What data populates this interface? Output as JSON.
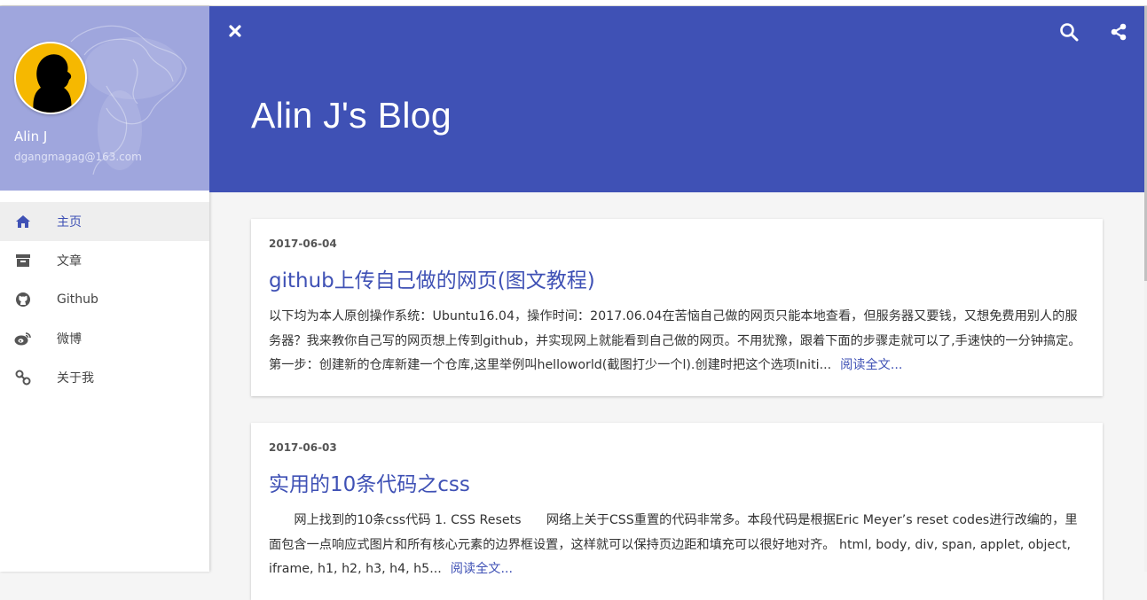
{
  "profile": {
    "name": "Alin J",
    "email": "dgangmagag@163.com"
  },
  "nav": {
    "items": [
      {
        "label": "主页",
        "icon": "home-icon",
        "active": true
      },
      {
        "label": "文章",
        "icon": "archive-icon",
        "active": false
      },
      {
        "label": "Github",
        "icon": "github-icon",
        "active": false
      },
      {
        "label": "微博",
        "icon": "weibo-icon",
        "active": false
      },
      {
        "label": "关于我",
        "icon": "link-icon",
        "active": false
      }
    ]
  },
  "header": {
    "title": "Alin J's Blog"
  },
  "posts": [
    {
      "date": "2017-06-04",
      "title": "github上传自己做的网页(图文教程)",
      "excerpt": "以下均为本人原创操作系统：Ubuntu16.04，操作时间：2017.06.04在苦恼自己做的网页只能本地查看，但服务器又要钱，又想免费用别人的服务器？我来教你自己写的网页想上传到github，并实现网上就能看到自己做的网页。不用犹豫，跟着下面的步骤走就可以了,手速快的一分钟搞定。第一步：创建新的仓库新建一个仓库,这里举例叫helloworld(截图打少一个l).创建时把这个选项Initi...",
      "read_more": "阅读全文..."
    },
    {
      "date": "2017-06-03",
      "title": "实用的10条代码之css",
      "excerpt": "　　网上找到的10条css代码 1. CSS Resets　　网络上关于CSS重置的代码非常多。本段代码是根据Eric Meyer’s reset codes进行改编的，里面包含一点响应式图片和所有核心元素的边界框设置，这样就可以保持页边距和填充可以很好地对齐。 html, body, div, span, applet, object, iframe, h1, h2, h3, h4, h5...",
      "read_more": "阅读全文..."
    }
  ],
  "colors": {
    "primary": "#3f51b5",
    "sidebar_header": "#9fa6dd",
    "avatar_bg": "#f6b800"
  }
}
